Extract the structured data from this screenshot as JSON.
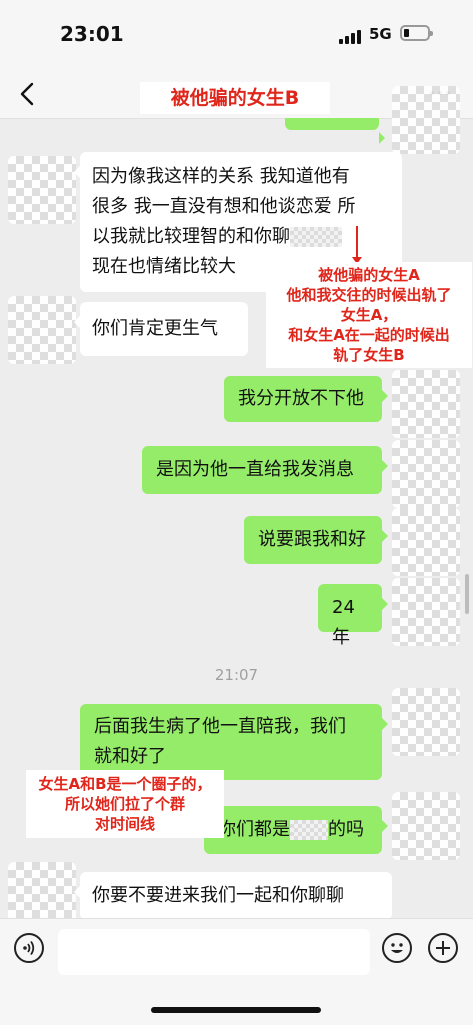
{
  "status": {
    "time": "23:01",
    "network": "5G"
  },
  "header": {
    "title": "被他骗的女生B"
  },
  "messages": [
    {
      "side": "in",
      "text_lines": [
        "因为像我这样的关系 我知道他有",
        "很多 我一直没有想和他谈恋爱 所",
        "以我就比较理智的和你聊",
        "现在也情绪比较大"
      ]
    },
    {
      "side": "in",
      "text": "你们肯定更生气"
    },
    {
      "side": "out",
      "text": "我分开放不下他"
    },
    {
      "side": "out",
      "text": "是因为他一直给我发消息"
    },
    {
      "side": "out",
      "text": "说要跟我和好"
    },
    {
      "side": "out",
      "text": "24年"
    },
    {
      "side": "out",
      "text_lines": [
        "后面我生病了他一直陪我，我们",
        "就和好了"
      ]
    },
    {
      "side": "out",
      "text_before": "你们都是",
      "text_after": "的吗"
    },
    {
      "side": "in",
      "text": "你要不要进来我们一起和你聊聊"
    }
  ],
  "timestamp": "21:07",
  "annotations": {
    "note1": [
      "被他骗的女生A",
      "他和我交往的时候出轨了",
      "女生A，",
      "和女生A在一起的时候出",
      "轨了女生B"
    ],
    "note2": [
      "女生A和B是一个圈子的，",
      "所以她们拉了个群",
      "对时间线"
    ]
  },
  "input": {
    "placeholder": ""
  },
  "icons": [
    "back-arrow-icon",
    "more-icon",
    "voice-icon",
    "emoji-icon",
    "plus-icon"
  ],
  "colors": {
    "outgoing_bubble": "#95ec69",
    "incoming_bubble": "#ffffff",
    "annotation_red": "#e0261b",
    "background": "#ededed"
  }
}
